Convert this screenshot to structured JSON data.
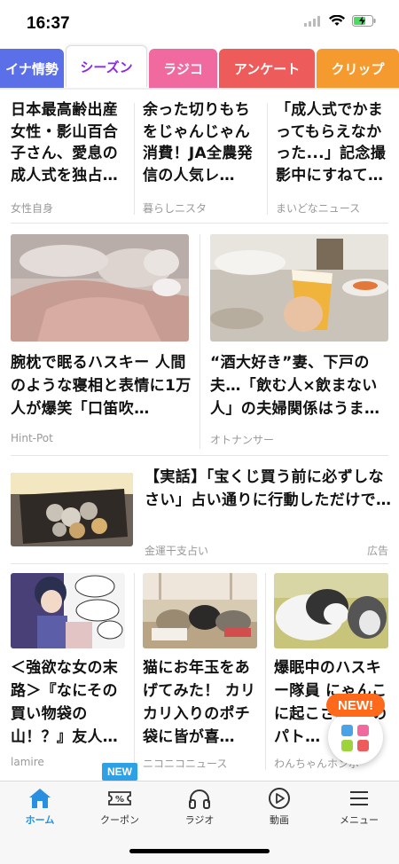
{
  "status_bar": {
    "time": "16:37"
  },
  "tabs": [
    {
      "label": "イナ情勢",
      "color": "#5b6fe8"
    },
    {
      "label": "シーズン",
      "color": "#ffffff",
      "active": true
    },
    {
      "label": "ラジコ",
      "color": "#f06aa0"
    },
    {
      "label": "アンケート",
      "color": "#ee5b5b"
    },
    {
      "label": "クリップ",
      "color": "#f59a2e"
    }
  ],
  "top_articles": [
    {
      "title": "日本最高齢出産女性・影山百合子さん、愛息の成人式を独占…",
      "source": "女性自身"
    },
    {
      "title": "余った切りもちをじゃんじゃん消費！JA全農発信の人気レ…",
      "source": "暮らしニスタ"
    },
    {
      "title": "「成人式でかまってもらえなかった...」記念撮影中にすねて…",
      "source": "まいどなニュース"
    }
  ],
  "feature_articles": [
    {
      "title": "腕枕で眠るハスキー 人間のような寝相と表情に1万人が爆笑「口笛吹…",
      "source": "Hint-Pot",
      "image": "husky-sleeping"
    },
    {
      "title": "“酒大好き”妻、下戸の夫…「飲む人×飲まない人」の夫婦関係はうま…",
      "source": "オトナンサー",
      "image": "beer-glass"
    }
  ],
  "ad": {
    "title": "【実話】「宝くじ買う前に必ずしなさい」占い通りに行動しただけで…",
    "source": "金運干支占い",
    "badge": "広告"
  },
  "bottom_articles": [
    {
      "title": "＜強欲な女の末路＞『なにその買い物袋の山！？』友人…",
      "source": "lamire"
    },
    {
      "title": "猫にお年玉をあげてみた！ カリカリ入りのポチ袋に皆が喜…",
      "source": "ニコニコニュース"
    },
    {
      "title": "爆眠中のハスキー隊員 にゃんこに起こさ… 中のパト…",
      "source": "わんちゃんホンポ"
    }
  ],
  "fab": {
    "badge": "NEW!",
    "icon": "app-grid-icon"
  },
  "new_tag": "NEW",
  "nav": [
    {
      "label": "ホーム",
      "icon": "home-icon",
      "active": true
    },
    {
      "label": "クーポン",
      "icon": "coupon-icon"
    },
    {
      "label": "ラジオ",
      "icon": "headphones-icon"
    },
    {
      "label": "動画",
      "icon": "play-icon"
    },
    {
      "label": "メニュー",
      "icon": "menu-icon"
    }
  ],
  "colors": {
    "accent": "#2a8fe0",
    "active_tab_text": "#8a2be2",
    "badge": "#ff6a1a"
  }
}
